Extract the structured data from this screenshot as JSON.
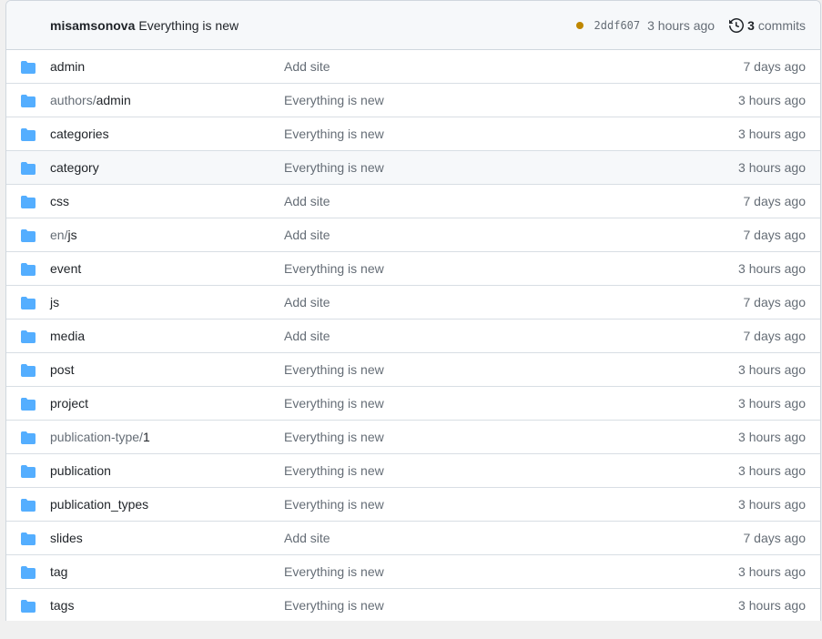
{
  "colors": {
    "folder": "#54aeff",
    "status_pending": "#bf8700"
  },
  "header": {
    "author": "misamsonova",
    "message": "Everything is new",
    "sha": "2ddf607",
    "time": "3 hours ago",
    "commits_count": "3",
    "commits_label": "commits"
  },
  "rows": [
    {
      "prefix": "",
      "name": "admin",
      "message": "Add site",
      "age": "7 days ago"
    },
    {
      "prefix": "authors/",
      "name": "admin",
      "message": "Everything is new",
      "age": "3 hours ago"
    },
    {
      "prefix": "",
      "name": "categories",
      "message": "Everything is new",
      "age": "3 hours ago"
    },
    {
      "prefix": "",
      "name": "category",
      "message": "Everything is new",
      "age": "3 hours ago"
    },
    {
      "prefix": "",
      "name": "css",
      "message": "Add site",
      "age": "7 days ago"
    },
    {
      "prefix": "en/",
      "name": "js",
      "message": "Add site",
      "age": "7 days ago"
    },
    {
      "prefix": "",
      "name": "event",
      "message": "Everything is new",
      "age": "3 hours ago"
    },
    {
      "prefix": "",
      "name": "js",
      "message": "Add site",
      "age": "7 days ago"
    },
    {
      "prefix": "",
      "name": "media",
      "message": "Add site",
      "age": "7 days ago"
    },
    {
      "prefix": "",
      "name": "post",
      "message": "Everything is new",
      "age": "3 hours ago"
    },
    {
      "prefix": "",
      "name": "project",
      "message": "Everything is new",
      "age": "3 hours ago"
    },
    {
      "prefix": "publication-type/",
      "name": "1",
      "message": "Everything is new",
      "age": "3 hours ago"
    },
    {
      "prefix": "",
      "name": "publication",
      "message": "Everything is new",
      "age": "3 hours ago"
    },
    {
      "prefix": "",
      "name": "publication_types",
      "message": "Everything is new",
      "age": "3 hours ago"
    },
    {
      "prefix": "",
      "name": "slides",
      "message": "Add site",
      "age": "7 days ago"
    },
    {
      "prefix": "",
      "name": "tag",
      "message": "Everything is new",
      "age": "3 hours ago"
    },
    {
      "prefix": "",
      "name": "tags",
      "message": "Everything is new",
      "age": "3 hours ago"
    }
  ]
}
